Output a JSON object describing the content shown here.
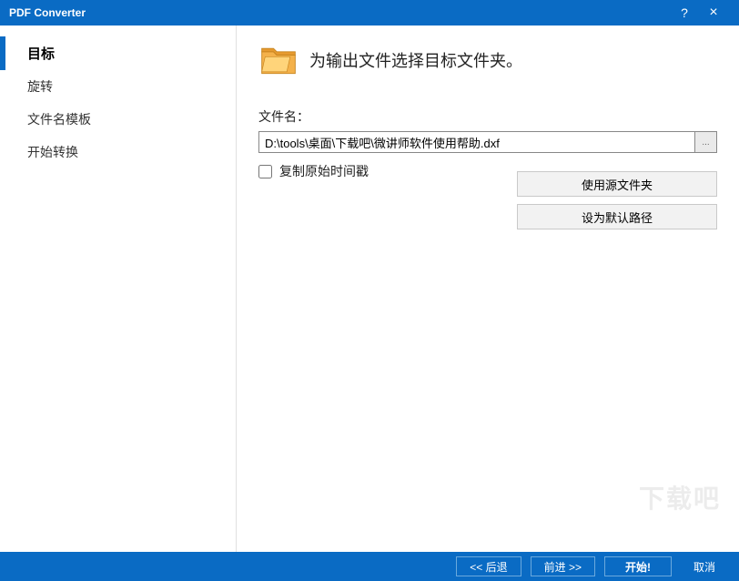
{
  "titlebar": {
    "title": "PDF Converter",
    "help": "?",
    "close": "×"
  },
  "sidebar": {
    "items": [
      {
        "label": "目标",
        "active": true
      },
      {
        "label": "旋转",
        "active": false
      },
      {
        "label": "文件名模板",
        "active": false
      },
      {
        "label": "开始转换",
        "active": false
      }
    ]
  },
  "content": {
    "heading": "为输出文件选择目标文件夹。",
    "filename_label": "文件名：",
    "path_value": "D:\\tools\\桌面\\下载吧\\微讲师软件使用帮助.dxf",
    "browse_label": "...",
    "copy_timestamp_label": "复制原始时间戳",
    "copy_timestamp_checked": false,
    "use_source_folder": "使用源文件夹",
    "set_default_path": "设为默认路径"
  },
  "footer": {
    "back": "<< 后退",
    "forward": "前进 >>",
    "start": "开始!",
    "cancel": "取消"
  },
  "watermark": "下载吧"
}
